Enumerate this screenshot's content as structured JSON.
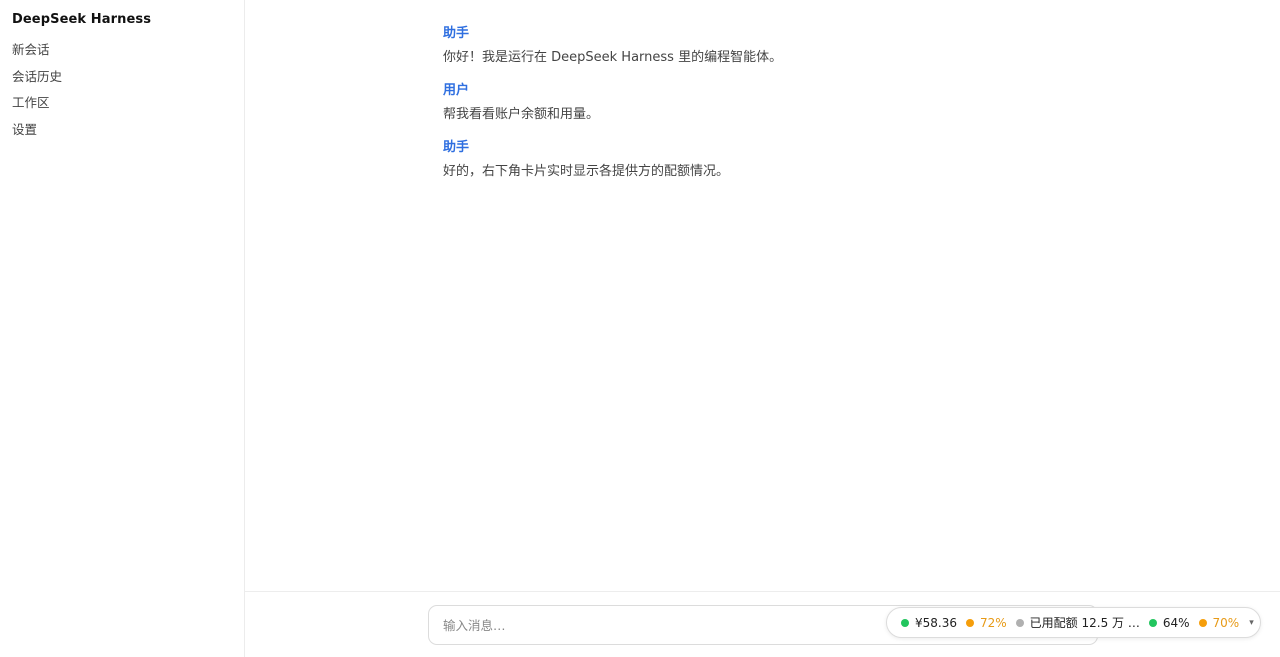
{
  "app": {
    "title": "DeepSeek Harness"
  },
  "sidebar": {
    "items": [
      {
        "label": "新会话"
      },
      {
        "label": "会话历史"
      },
      {
        "label": "工作区"
      },
      {
        "label": "设置"
      }
    ]
  },
  "messages": [
    {
      "role": "助手",
      "text": "你好！我是运行在 DeepSeek Harness 里的编程智能体。"
    },
    {
      "role": "用户",
      "text": "帮我看看账户余额和用量。"
    },
    {
      "role": "助手",
      "text": "好的，右下角卡片实时显示各提供方的配额情况。"
    }
  ],
  "input": {
    "placeholder": "输入消息…"
  },
  "quota": {
    "items": [
      {
        "status_color": "#22c55e",
        "value": "¥58.36",
        "warn": false
      },
      {
        "status_color": "#f59e0b",
        "value": "72%",
        "warn": true
      },
      {
        "status_color": "#b0b0b0",
        "value": "已用配额 12.5 万 …",
        "warn": false
      },
      {
        "status_color": "#22c55e",
        "value": "64%",
        "warn": false
      },
      {
        "status_color": "#f59e0b",
        "value": "70%",
        "warn": true
      }
    ],
    "expand_icon": "▾"
  },
  "colors": {
    "accent": "#2f6fe0",
    "ok": "#22c55e",
    "warn": "#f59e0b",
    "neutral": "#b0b0b0"
  }
}
